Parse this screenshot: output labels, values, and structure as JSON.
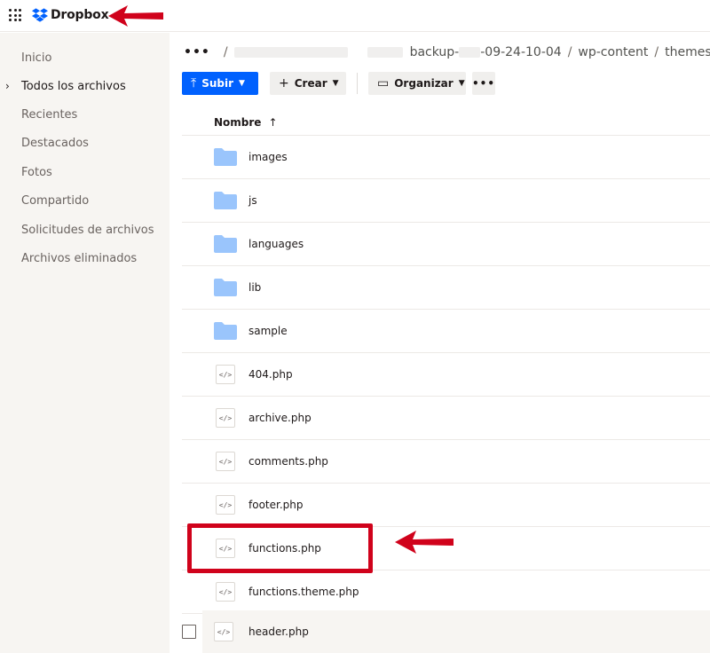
{
  "app": {
    "brand": "Dropbox"
  },
  "sidebar": {
    "items": [
      {
        "label": "Inicio",
        "active": false
      },
      {
        "label": "Todos los archivos",
        "active": true
      },
      {
        "label": "Recientes",
        "active": false
      },
      {
        "label": "Destacados",
        "active": false
      },
      {
        "label": "Fotos",
        "active": false
      },
      {
        "label": "Compartido",
        "active": false
      },
      {
        "label": "Solicitudes de archivos",
        "active": false
      },
      {
        "label": "Archivos eliminados",
        "active": false
      }
    ],
    "chevron": "›"
  },
  "breadcrumb": {
    "more": "•••",
    "separator": "/",
    "segment_backup_prefix": "backup-",
    "segment_backup_suffix": "-09-24-10-04",
    "segment_wp": "wp-content",
    "segment_themes": "themes",
    "trailing": "/"
  },
  "toolbar": {
    "upload_label": "Subir",
    "create_label": "Crear",
    "organize_label": "Organizar",
    "more_label": "•••"
  },
  "list": {
    "header_name": "Nombre",
    "sort_indicator": "↑",
    "rows": [
      {
        "name": "images",
        "type": "folder"
      },
      {
        "name": "js",
        "type": "folder"
      },
      {
        "name": "languages",
        "type": "folder"
      },
      {
        "name": "lib",
        "type": "folder"
      },
      {
        "name": "sample",
        "type": "folder"
      },
      {
        "name": "404.php",
        "type": "file"
      },
      {
        "name": "archive.php",
        "type": "file"
      },
      {
        "name": "comments.php",
        "type": "file"
      },
      {
        "name": "footer.php",
        "type": "file"
      },
      {
        "name": "functions.php",
        "type": "file"
      },
      {
        "name": "functions.theme.php",
        "type": "file"
      },
      {
        "name": "header.php",
        "type": "file"
      }
    ],
    "file_glyph": "</>"
  },
  "colors": {
    "accent": "#0061fe",
    "folder": "#9ac5fc",
    "annotation": "#d0021b",
    "sidebar_bg": "#f7f5f2"
  }
}
